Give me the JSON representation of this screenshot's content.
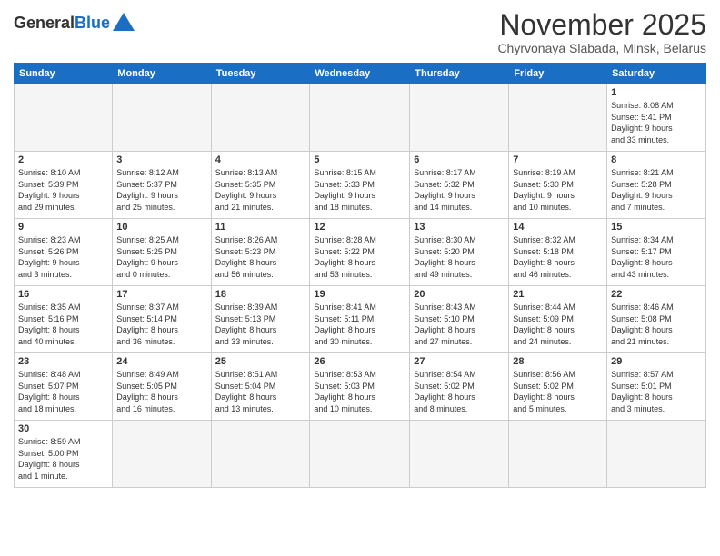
{
  "logo": {
    "general": "General",
    "blue": "Blue"
  },
  "title": "November 2025",
  "subtitle": "Chyrvonaya Slabada, Minsk, Belarus",
  "days_header": [
    "Sunday",
    "Monday",
    "Tuesday",
    "Wednesday",
    "Thursday",
    "Friday",
    "Saturday"
  ],
  "weeks": [
    [
      {
        "day": "",
        "info": ""
      },
      {
        "day": "",
        "info": ""
      },
      {
        "day": "",
        "info": ""
      },
      {
        "day": "",
        "info": ""
      },
      {
        "day": "",
        "info": ""
      },
      {
        "day": "",
        "info": ""
      },
      {
        "day": "1",
        "info": "Sunrise: 8:08 AM\nSunset: 5:41 PM\nDaylight: 9 hours\nand 33 minutes."
      }
    ],
    [
      {
        "day": "2",
        "info": "Sunrise: 8:10 AM\nSunset: 5:39 PM\nDaylight: 9 hours\nand 29 minutes."
      },
      {
        "day": "3",
        "info": "Sunrise: 8:12 AM\nSunset: 5:37 PM\nDaylight: 9 hours\nand 25 minutes."
      },
      {
        "day": "4",
        "info": "Sunrise: 8:13 AM\nSunset: 5:35 PM\nDaylight: 9 hours\nand 21 minutes."
      },
      {
        "day": "5",
        "info": "Sunrise: 8:15 AM\nSunset: 5:33 PM\nDaylight: 9 hours\nand 18 minutes."
      },
      {
        "day": "6",
        "info": "Sunrise: 8:17 AM\nSunset: 5:32 PM\nDaylight: 9 hours\nand 14 minutes."
      },
      {
        "day": "7",
        "info": "Sunrise: 8:19 AM\nSunset: 5:30 PM\nDaylight: 9 hours\nand 10 minutes."
      },
      {
        "day": "8",
        "info": "Sunrise: 8:21 AM\nSunset: 5:28 PM\nDaylight: 9 hours\nand 7 minutes."
      }
    ],
    [
      {
        "day": "9",
        "info": "Sunrise: 8:23 AM\nSunset: 5:26 PM\nDaylight: 9 hours\nand 3 minutes."
      },
      {
        "day": "10",
        "info": "Sunrise: 8:25 AM\nSunset: 5:25 PM\nDaylight: 9 hours\nand 0 minutes."
      },
      {
        "day": "11",
        "info": "Sunrise: 8:26 AM\nSunset: 5:23 PM\nDaylight: 8 hours\nand 56 minutes."
      },
      {
        "day": "12",
        "info": "Sunrise: 8:28 AM\nSunset: 5:22 PM\nDaylight: 8 hours\nand 53 minutes."
      },
      {
        "day": "13",
        "info": "Sunrise: 8:30 AM\nSunset: 5:20 PM\nDaylight: 8 hours\nand 49 minutes."
      },
      {
        "day": "14",
        "info": "Sunrise: 8:32 AM\nSunset: 5:18 PM\nDaylight: 8 hours\nand 46 minutes."
      },
      {
        "day": "15",
        "info": "Sunrise: 8:34 AM\nSunset: 5:17 PM\nDaylight: 8 hours\nand 43 minutes."
      }
    ],
    [
      {
        "day": "16",
        "info": "Sunrise: 8:35 AM\nSunset: 5:16 PM\nDaylight: 8 hours\nand 40 minutes."
      },
      {
        "day": "17",
        "info": "Sunrise: 8:37 AM\nSunset: 5:14 PM\nDaylight: 8 hours\nand 36 minutes."
      },
      {
        "day": "18",
        "info": "Sunrise: 8:39 AM\nSunset: 5:13 PM\nDaylight: 8 hours\nand 33 minutes."
      },
      {
        "day": "19",
        "info": "Sunrise: 8:41 AM\nSunset: 5:11 PM\nDaylight: 8 hours\nand 30 minutes."
      },
      {
        "day": "20",
        "info": "Sunrise: 8:43 AM\nSunset: 5:10 PM\nDaylight: 8 hours\nand 27 minutes."
      },
      {
        "day": "21",
        "info": "Sunrise: 8:44 AM\nSunset: 5:09 PM\nDaylight: 8 hours\nand 24 minutes."
      },
      {
        "day": "22",
        "info": "Sunrise: 8:46 AM\nSunset: 5:08 PM\nDaylight: 8 hours\nand 21 minutes."
      }
    ],
    [
      {
        "day": "23",
        "info": "Sunrise: 8:48 AM\nSunset: 5:07 PM\nDaylight: 8 hours\nand 18 minutes."
      },
      {
        "day": "24",
        "info": "Sunrise: 8:49 AM\nSunset: 5:05 PM\nDaylight: 8 hours\nand 16 minutes."
      },
      {
        "day": "25",
        "info": "Sunrise: 8:51 AM\nSunset: 5:04 PM\nDaylight: 8 hours\nand 13 minutes."
      },
      {
        "day": "26",
        "info": "Sunrise: 8:53 AM\nSunset: 5:03 PM\nDaylight: 8 hours\nand 10 minutes."
      },
      {
        "day": "27",
        "info": "Sunrise: 8:54 AM\nSunset: 5:02 PM\nDaylight: 8 hours\nand 8 minutes."
      },
      {
        "day": "28",
        "info": "Sunrise: 8:56 AM\nSunset: 5:02 PM\nDaylight: 8 hours\nand 5 minutes."
      },
      {
        "day": "29",
        "info": "Sunrise: 8:57 AM\nSunset: 5:01 PM\nDaylight: 8 hours\nand 3 minutes."
      }
    ],
    [
      {
        "day": "30",
        "info": "Sunrise: 8:59 AM\nSunset: 5:00 PM\nDaylight: 8 hours\nand 1 minute."
      },
      {
        "day": "",
        "info": ""
      },
      {
        "day": "",
        "info": ""
      },
      {
        "day": "",
        "info": ""
      },
      {
        "day": "",
        "info": ""
      },
      {
        "day": "",
        "info": ""
      },
      {
        "day": "",
        "info": ""
      }
    ]
  ]
}
